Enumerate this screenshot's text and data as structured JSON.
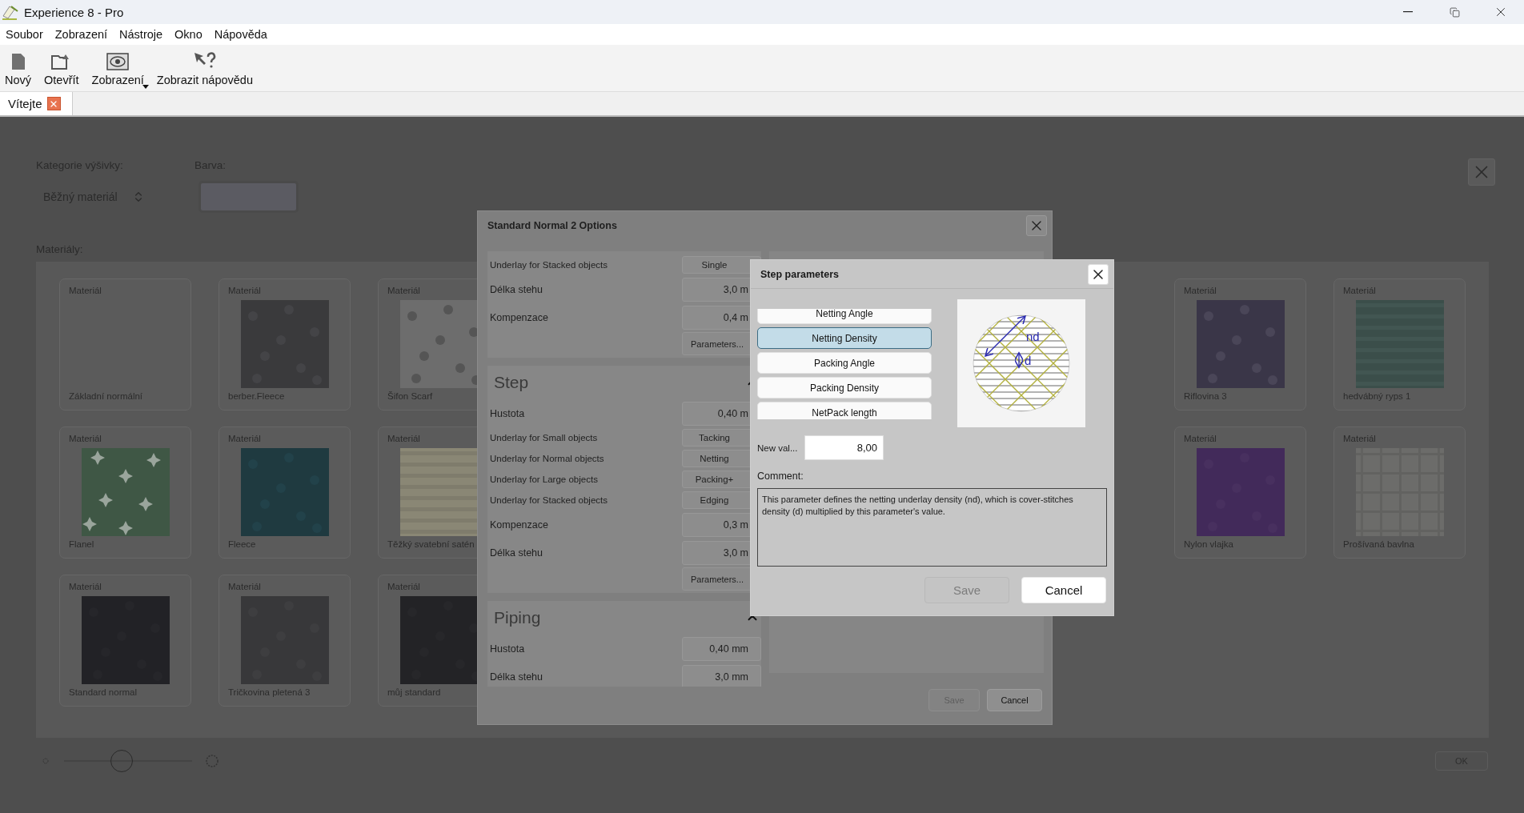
{
  "window": {
    "title": "Experience 8 - Pro"
  },
  "menu": [
    "Soubor",
    "Zobrazení",
    "Nástroje",
    "Okno",
    "Nápověda"
  ],
  "toolbar": [
    {
      "kind": "new",
      "label": "Nový",
      "dropdown": false
    },
    {
      "kind": "open",
      "label": "Otevřít",
      "dropdown": false
    },
    {
      "kind": "view",
      "label": "Zobrazení",
      "dropdown": true
    },
    {
      "kind": "help",
      "label": "Zobrazit nápovědu",
      "dropdown": false
    }
  ],
  "tabs": [
    {
      "label": "Vítejte",
      "selected": true
    }
  ],
  "category": {
    "label": "Kategorie výšivky:",
    "value": "Běžný materiál"
  },
  "color": {
    "label": "Barva:"
  },
  "materials": {
    "label": "Materiály:",
    "rows": [
      {
        "left": [
          {
            "caption": "Materiál",
            "name": "Základní normální",
            "kind": "blank"
          },
          {
            "caption": "Materiál",
            "name": "berber.Fleece",
            "kind": "picture"
          },
          {
            "caption": "Materiál",
            "name": "Šifon Scarf",
            "kind": "picture"
          }
        ],
        "right": [
          {
            "caption": "Materiál",
            "name": "Riflovina 3",
            "kind": "picture"
          },
          {
            "caption": "Materiál",
            "name": "hedvábný ryps 1",
            "kind": "picture"
          }
        ]
      },
      {
        "left": [
          {
            "caption": "Materiál",
            "name": "Flanel",
            "kind": "picture"
          },
          {
            "caption": "Materiál",
            "name": "Fleece",
            "kind": "picture"
          },
          {
            "caption": "Materiál",
            "name": "Těžký svatební satén",
            "kind": "picture"
          }
        ],
        "right": [
          {
            "caption": "Materiál",
            "name": "Nylon vlajka",
            "kind": "picture"
          },
          {
            "caption": "Materiál",
            "name": "Prošívaná bavlna",
            "kind": "picture"
          }
        ]
      },
      {
        "left": [
          {
            "caption": "Materiál",
            "name": "Standard normal",
            "kind": "picture"
          },
          {
            "caption": "Materiál",
            "name": "Tričkovina pletená 3",
            "kind": "picture"
          },
          {
            "caption": "Materiál",
            "name": "můj standard",
            "kind": "picture"
          }
        ]
      }
    ]
  },
  "ok_button": "OK",
  "options_dialog": {
    "title": "Standard Normal 2 Options",
    "sections": [
      {
        "rows": [
          {
            "kind": "choice",
            "label": "Underlay for Stacked objects",
            "value": "Single"
          },
          {
            "kind": "measure",
            "label": "Délka stehu",
            "value": "3,0 m"
          },
          {
            "kind": "measure",
            "label": "Kompenzace",
            "value": "0,4 m"
          },
          {
            "kind": "button",
            "label": "Parameters..."
          }
        ]
      },
      {
        "heading": "Step",
        "expanded": true,
        "rows": [
          {
            "kind": "measure",
            "label": "Hustota",
            "value": "0,40 m"
          },
          {
            "kind": "choice",
            "label": "Underlay for Small objects",
            "value": "Tacking"
          },
          {
            "kind": "choice",
            "label": "Underlay for Normal objects",
            "value": "Netting"
          },
          {
            "kind": "choice",
            "label": "Underlay for Large objects",
            "value": "Packing+"
          },
          {
            "kind": "choice",
            "label": "Underlay for Stacked objects",
            "value": "Edging"
          },
          {
            "kind": "measure",
            "label": "Kompenzace",
            "value": "0,3 m"
          },
          {
            "kind": "measure",
            "label": "Délka stehu",
            "value": "3,0 m"
          },
          {
            "kind": "button",
            "label": "Parameters..."
          }
        ]
      },
      {
        "heading": "Piping",
        "expanded": true,
        "rows": [
          {
            "kind": "measure",
            "label": "Hustota",
            "value": "0,40 mm"
          },
          {
            "kind": "measure",
            "label": "Délka stehu",
            "value": "3,0 mm"
          }
        ]
      }
    ],
    "buttons": [
      {
        "label": "Save",
        "disabled": true
      },
      {
        "label": "Cancel",
        "disabled": false
      }
    ]
  },
  "step_dialog": {
    "title": "Step parameters",
    "parameters": [
      {
        "label": "Netting Angle",
        "selected": false
      },
      {
        "label": "Netting Density",
        "selected": true
      },
      {
        "label": "Packing Angle",
        "selected": false
      },
      {
        "label": "Packing Density",
        "selected": false
      },
      {
        "label": "NetPack length",
        "selected": false
      }
    ],
    "diagram": {
      "labels": [
        "nd",
        "d"
      ]
    },
    "new_value": {
      "label": "New val...",
      "value": "8,00"
    },
    "comment": {
      "label": "Comment:",
      "text": "This parameter defines the netting underlay density (nd), which is cover-stitches density (d) multiplied by this parameter's value."
    },
    "buttons": [
      {
        "label": "Save",
        "disabled": true
      },
      {
        "label": "Cancel",
        "disabled": false
      }
    ]
  }
}
